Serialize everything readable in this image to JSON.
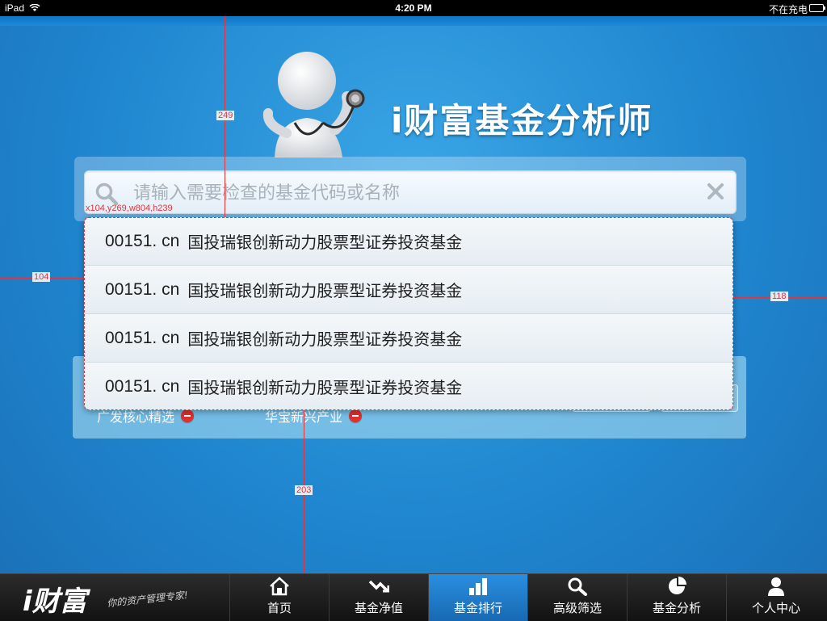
{
  "status_bar": {
    "device": "iPad",
    "time": "4:20 PM",
    "charging": "不在充电"
  },
  "app": {
    "title": "i财富基金分析师"
  },
  "search": {
    "placeholder": "请输入需要检查的基金代码或名称"
  },
  "results": [
    {
      "code": "00151. cn",
      "name": "国投瑞银创新动力股票型证券投资基金"
    },
    {
      "code": "00151. cn",
      "name": "国投瑞银创新动力股票型证券投资基金"
    },
    {
      "code": "00151. cn",
      "name": "国投瑞银创新动力股票型证券投资基金"
    },
    {
      "code": "00151. cn",
      "name": "国投瑞银创新动力股票型证券投资基金"
    }
  ],
  "selected_funds": [
    {
      "label": "广发核心精选"
    },
    {
      "label": "华宝新兴产业"
    }
  ],
  "annotations": {
    "dropdown_box": "x104,y269,w804,h239",
    "top_gap": "249",
    "left_gap": "104",
    "right_gap": "118",
    "bottom_gap": "203"
  },
  "tab_bar": {
    "logo": "i财富",
    "slogan": "你的资产管理专家!",
    "tabs": [
      {
        "label": "首页",
        "icon": "home-icon",
        "active": false
      },
      {
        "label": "基金净值",
        "icon": "trend-icon",
        "active": false
      },
      {
        "label": "基金排行",
        "icon": "bar-chart-icon",
        "active": true
      },
      {
        "label": "高级筛选",
        "icon": "magnifier-icon",
        "active": false
      },
      {
        "label": "基金分析",
        "icon": "pie-chart-icon",
        "active": false
      },
      {
        "label": "个人中心",
        "icon": "person-icon",
        "active": false
      }
    ]
  },
  "colors": {
    "accent": "#1f86cf",
    "active_tab": "#2a8fe0",
    "annotation": "#e2343b",
    "remove": "#e0302c"
  }
}
